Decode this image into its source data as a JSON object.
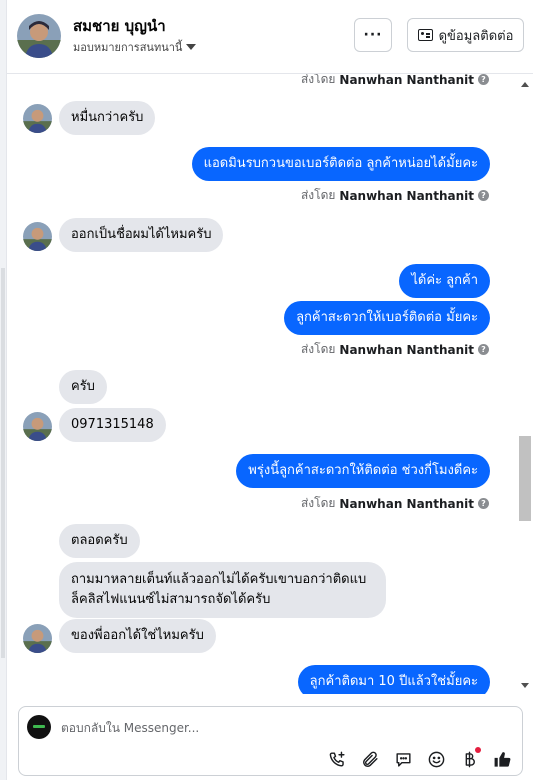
{
  "header": {
    "name": "สมชาย บุญนำ",
    "assign_label": "มอบหมายการสนทนานี้",
    "more_label": "···",
    "details_label": "ดูข้อมูลติดต่อ"
  },
  "sent_by": {
    "prefix": "ส่งโดย",
    "name": "Nanwhan Nanthanit"
  },
  "messages": [
    {
      "dir": "in",
      "text": "หมื่นกว่าครับ"
    },
    {
      "dir": "out",
      "text": "แอดมินรบกวนขอเบอร์ติดต่อ ลูกค้าหน่อยได้มั้ยคะ"
    },
    {
      "dir": "in",
      "text": "ออกเป็นชื่อผมได้ไหมครับ"
    },
    {
      "dir": "out",
      "text": "ได้ค่ะ ลูกค้า"
    },
    {
      "dir": "out",
      "text": "ลูกค้าสะดวกให้เบอร์ติดต่อ มั้ยคะ"
    },
    {
      "dir": "in",
      "text": "ครับ"
    },
    {
      "dir": "in",
      "text": "0971315148"
    },
    {
      "dir": "out",
      "text": "พรุ่งนี้ลูกค้าสะดวกให้ติดต่อ ช่วงกี่โมงดีคะ"
    },
    {
      "dir": "in",
      "text": "ตลอดครับ"
    },
    {
      "dir": "in",
      "text": "ถามมาหลายเต็นท์แล้วออกไม่ได้ครับเขาบอกว่าติดแบล็คลิสไฟแนนซ์ไม่สามารถจัดได้ครับ"
    },
    {
      "dir": "in",
      "text": "ของพี่ออกได้ใช่ไหมครับ"
    },
    {
      "dir": "out",
      "text": "ลูกค้าติดมา 10 ปีแล้วใช่มั้ยคะ"
    }
  ],
  "composer": {
    "placeholder": "ตอบกลับใน Messenger..."
  },
  "icons": [
    "phone-plus-icon",
    "paperclip-icon",
    "saved-reply-icon",
    "emoji-icon",
    "baht-icon",
    "thumbs-up-icon"
  ],
  "colors": {
    "outgoing_bubble": "#0866ff",
    "incoming_bubble": "#e4e6eb"
  }
}
